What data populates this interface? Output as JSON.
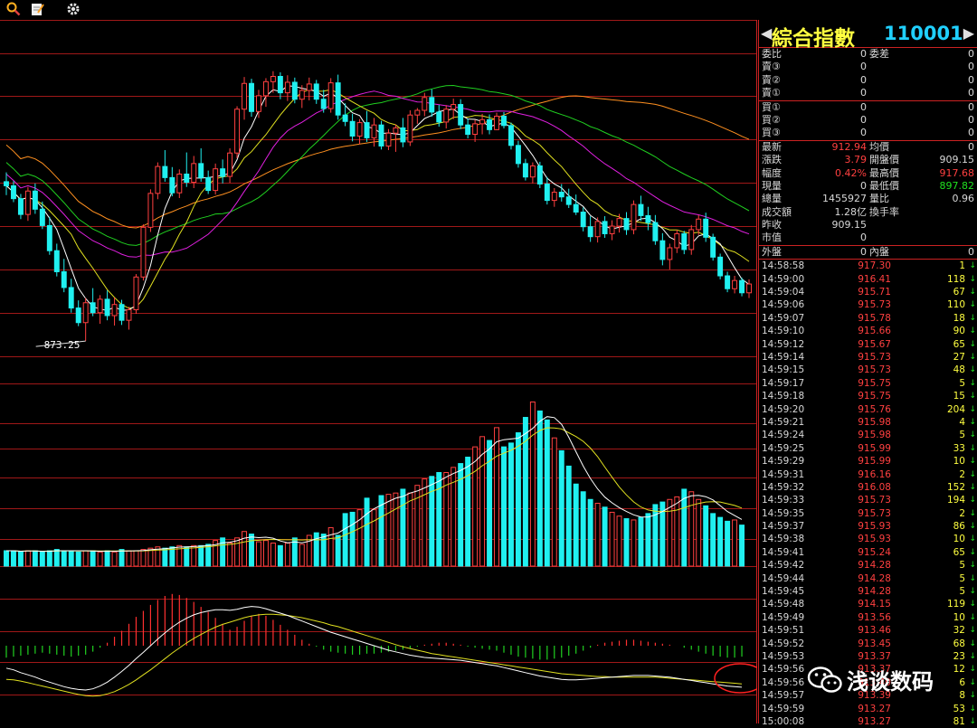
{
  "toolbar": {
    "icons": [
      "magnifier-icon",
      "notepad-icon",
      "gear-icon"
    ]
  },
  "header": {
    "name": "綜合指數",
    "code": "110001"
  },
  "quote_rows": [
    {
      "l1": "委比",
      "v1": "0",
      "l2": "委差",
      "v2": "0",
      "c1": "#d8d8d8",
      "c2": "#d8d8d8",
      "sep": false
    },
    {
      "l1": "賣③",
      "v1": "0",
      "l2": "",
      "v2": "0",
      "c1": "#d8d8d8",
      "c2": "#d8d8d8",
      "sep": false
    },
    {
      "l1": "賣②",
      "v1": "0",
      "l2": "",
      "v2": "0",
      "c1": "#d8d8d8",
      "c2": "#d8d8d8",
      "sep": false
    },
    {
      "l1": "賣①",
      "v1": "0",
      "l2": "",
      "v2": "0",
      "c1": "#d8d8d8",
      "c2": "#d8d8d8",
      "sep": true
    },
    {
      "l1": "買①",
      "v1": "0",
      "l2": "",
      "v2": "0",
      "c1": "#d8d8d8",
      "c2": "#d8d8d8",
      "sep": false
    },
    {
      "l1": "買②",
      "v1": "0",
      "l2": "",
      "v2": "0",
      "c1": "#d8d8d8",
      "c2": "#d8d8d8",
      "sep": false
    },
    {
      "l1": "買③",
      "v1": "0",
      "l2": "",
      "v2": "0",
      "c1": "#d8d8d8",
      "c2": "#d8d8d8",
      "sep": true
    },
    {
      "l1": "最新",
      "v1": "912.94",
      "l2": "均價",
      "v2": "0",
      "c1": "#ff4040",
      "c2": "#d8d8d8",
      "sep": false
    },
    {
      "l1": "漲跌",
      "v1": "3.79",
      "l2": "開盤價",
      "v2": "909.15",
      "c1": "#ff4040",
      "c2": "#d8d8d8",
      "sep": false
    },
    {
      "l1": "幅度",
      "v1": "0.42%",
      "l2": "最高價",
      "v2": "917.68",
      "c1": "#ff4040",
      "c2": "#ff4040",
      "sep": false
    },
    {
      "l1": "現量",
      "v1": "0",
      "l2": "最低價",
      "v2": "897.82",
      "c1": "#d8d8d8",
      "c2": "#20e020",
      "sep": false
    },
    {
      "l1": "總量",
      "v1": "1455927",
      "l2": "量比",
      "v2": "0.96",
      "c1": "#d8d8d8",
      "c2": "#d8d8d8",
      "sep": false
    },
    {
      "l1": "成交額",
      "v1": "1.28亿",
      "l2": "換手率",
      "v2": "",
      "c1": "#d8d8d8",
      "c2": "#d8d8d8",
      "sep": false
    },
    {
      "l1": "昨收",
      "v1": "909.15",
      "l2": "",
      "v2": "",
      "c1": "#d8d8d8",
      "c2": "#d8d8d8",
      "sep": false
    },
    {
      "l1": "市值",
      "v1": "0",
      "l2": "",
      "v2": "",
      "c1": "#d8d8d8",
      "c2": "#d8d8d8",
      "sep": true
    },
    {
      "l1": "外盤",
      "v1": "0",
      "l2": "內盤",
      "v2": "0",
      "c1": "#d8d8d8",
      "c2": "#d8d8d8",
      "sep": true
    }
  ],
  "ticks": [
    {
      "t": "14:58:58",
      "p": "917.30",
      "q": "1",
      "dir": "down"
    },
    {
      "t": "14:59:00",
      "p": "916.41",
      "q": "118",
      "dir": "down"
    },
    {
      "t": "14:59:04",
      "p": "915.71",
      "q": "67",
      "dir": "down"
    },
    {
      "t": "14:59:06",
      "p": "915.73",
      "q": "110",
      "dir": "down"
    },
    {
      "t": "14:59:07",
      "p": "915.78",
      "q": "18",
      "dir": "down"
    },
    {
      "t": "14:59:10",
      "p": "915.66",
      "q": "90",
      "dir": "down"
    },
    {
      "t": "14:59:12",
      "p": "915.67",
      "q": "65",
      "dir": "down"
    },
    {
      "t": "14:59:14",
      "p": "915.73",
      "q": "27",
      "dir": "down"
    },
    {
      "t": "14:59:15",
      "p": "915.73",
      "q": "48",
      "dir": "down"
    },
    {
      "t": "14:59:17",
      "p": "915.75",
      "q": "5",
      "dir": "down"
    },
    {
      "t": "14:59:18",
      "p": "915.75",
      "q": "15",
      "dir": "down"
    },
    {
      "t": "14:59:20",
      "p": "915.76",
      "q": "204",
      "dir": "down"
    },
    {
      "t": "14:59:21",
      "p": "915.98",
      "q": "4",
      "dir": "down"
    },
    {
      "t": "14:59:24",
      "p": "915.98",
      "q": "5",
      "dir": "down"
    },
    {
      "t": "14:59:25",
      "p": "915.99",
      "q": "33",
      "dir": "down"
    },
    {
      "t": "14:59:29",
      "p": "915.99",
      "q": "10",
      "dir": "down"
    },
    {
      "t": "14:59:31",
      "p": "916.16",
      "q": "2",
      "dir": "down"
    },
    {
      "t": "14:59:32",
      "p": "916.08",
      "q": "152",
      "dir": "down"
    },
    {
      "t": "14:59:33",
      "p": "915.73",
      "q": "194",
      "dir": "down"
    },
    {
      "t": "14:59:35",
      "p": "915.73",
      "q": "2",
      "dir": "down"
    },
    {
      "t": "14:59:37",
      "p": "915.93",
      "q": "86",
      "dir": "down"
    },
    {
      "t": "14:59:38",
      "p": "915.93",
      "q": "10",
      "dir": "down"
    },
    {
      "t": "14:59:41",
      "p": "915.24",
      "q": "65",
      "dir": "down"
    },
    {
      "t": "14:59:42",
      "p": "914.28",
      "q": "5",
      "dir": "down"
    },
    {
      "t": "14:59:44",
      "p": "914.28",
      "q": "5",
      "dir": "down"
    },
    {
      "t": "14:59:45",
      "p": "914.28",
      "q": "5",
      "dir": "down"
    },
    {
      "t": "14:59:48",
      "p": "914.15",
      "q": "119",
      "dir": "down"
    },
    {
      "t": "14:59:49",
      "p": "913.56",
      "q": "10",
      "dir": "down"
    },
    {
      "t": "14:59:51",
      "p": "913.46",
      "q": "32",
      "dir": "down"
    },
    {
      "t": "14:59:52",
      "p": "913.45",
      "q": "68",
      "dir": "down"
    },
    {
      "t": "14:59:53",
      "p": "913.37",
      "q": "23",
      "dir": "down"
    },
    {
      "t": "14:59:56",
      "p": "913.37",
      "q": "12",
      "dir": "down"
    },
    {
      "t": "14:59:56",
      "p": "913.40",
      "q": "6",
      "dir": "down"
    },
    {
      "t": "14:59:57",
      "p": "913.39",
      "q": "8",
      "dir": "down"
    },
    {
      "t": "14:59:59",
      "p": "913.27",
      "q": "53",
      "dir": "down"
    },
    {
      "t": "15:00:08",
      "p": "913.27",
      "q": "81",
      "dir": "down"
    }
  ],
  "watermark": {
    "text": "浅谈数码"
  },
  "chart_data": {
    "type": "candlestick",
    "low_label": "873.25",
    "ylim": [
      866,
      926
    ],
    "colors": {
      "up": "#ff4040",
      "down": "#20f0f0",
      "ma5": "#ffffff",
      "ma10": "#e0e020",
      "ma20": "#e020e0",
      "ma30": "#20d020",
      "ma60": "#ff9020",
      "macd_pos": "#ff3030",
      "macd_neg": "#20d020",
      "dif": "#ffffff",
      "dea": "#e0e020"
    },
    "candles": [
      [
        900.5,
        902.1,
        898.2,
        899.8
      ],
      [
        899.8,
        900.6,
        897.0,
        897.6
      ],
      [
        897.6,
        898.4,
        894.1,
        894.9
      ],
      [
        894.9,
        899.6,
        893.8,
        898.9
      ],
      [
        898.9,
        900.2,
        895.0,
        895.8
      ],
      [
        895.8,
        897.1,
        892.4,
        893.0
      ],
      [
        893.0,
        894.5,
        888.0,
        888.7
      ],
      [
        888.7,
        889.9,
        884.3,
        885.1
      ],
      [
        885.1,
        887.3,
        881.6,
        882.4
      ],
      [
        882.4,
        883.9,
        878.1,
        878.9
      ],
      [
        878.9,
        880.2,
        875.8,
        876.4
      ],
      [
        876.4,
        880.6,
        873.25,
        879.8
      ],
      [
        879.8,
        882.3,
        877.5,
        878.1
      ],
      [
        878.1,
        881.1,
        876.2,
        880.4
      ],
      [
        880.4,
        881.9,
        876.8,
        877.6
      ],
      [
        877.6,
        880.7,
        875.9,
        879.5
      ],
      [
        879.5,
        880.3,
        876.0,
        876.8
      ],
      [
        876.8,
        879.1,
        875.2,
        878.6
      ],
      [
        878.6,
        884.7,
        877.9,
        884.2
      ],
      [
        884.2,
        893.2,
        883.6,
        892.7
      ],
      [
        892.7,
        899.2,
        891.9,
        898.5
      ],
      [
        898.5,
        903.8,
        897.5,
        903.1
      ],
      [
        903.1,
        905.9,
        900.5,
        901.2
      ],
      [
        901.2,
        903.0,
        898.0,
        898.6
      ],
      [
        898.6,
        902.6,
        897.7,
        901.8
      ],
      [
        901.8,
        905.5,
        899.6,
        900.4
      ],
      [
        900.4,
        904.9,
        899.4,
        903.6
      ],
      [
        903.6,
        906.2,
        900.5,
        901.2
      ],
      [
        901.2,
        902.4,
        898.4,
        899.0
      ],
      [
        899.0,
        903.6,
        898.3,
        902.7
      ],
      [
        902.7,
        904.3,
        900.2,
        901.4
      ],
      [
        901.4,
        906.2,
        900.3,
        905.4
      ],
      [
        905.4,
        913.4,
        904.5,
        912.9
      ],
      [
        912.9,
        918.4,
        911.1,
        917.3
      ],
      [
        917.3,
        918.1,
        911.6,
        912.5
      ],
      [
        912.5,
        916.2,
        911.4,
        915.2
      ],
      [
        915.2,
        918.2,
        913.3,
        917.6
      ],
      [
        917.6,
        919.4,
        915.7,
        918.5
      ],
      [
        918.5,
        919.2,
        914.6,
        915.7
      ],
      [
        915.7,
        918.7,
        914.3,
        917.5
      ],
      [
        917.5,
        918.3,
        913.9,
        914.6
      ],
      [
        914.6,
        917.0,
        913.1,
        916.1
      ],
      [
        916.1,
        918.3,
        914.4,
        917.2
      ],
      [
        917.2,
        917.9,
        913.8,
        914.6
      ],
      [
        914.6,
        916.2,
        912.3,
        913.0
      ],
      [
        913.0,
        918.2,
        912.3,
        917.4
      ],
      [
        917.4,
        918.8,
        911.1,
        911.9
      ],
      [
        911.9,
        913.9,
        910.0,
        910.8
      ],
      [
        910.8,
        912.1,
        907.4,
        908.3
      ],
      [
        908.3,
        911.2,
        906.9,
        910.6
      ],
      [
        910.6,
        912.6,
        907.3,
        908.0
      ],
      [
        908.0,
        911.4,
        906.5,
        910.2
      ],
      [
        910.2,
        910.9,
        906.0,
        906.6
      ],
      [
        906.6,
        909.5,
        905.9,
        908.8
      ],
      [
        908.8,
        910.3,
        905.6,
        909.7
      ],
      [
        909.7,
        911.4,
        906.4,
        907.3
      ],
      [
        907.3,
        912.7,
        906.6,
        911.9
      ],
      [
        911.9,
        913.1,
        910.4,
        912.7
      ],
      [
        912.7,
        915.7,
        911.7,
        914.9
      ],
      [
        914.9,
        916.3,
        911.6,
        912.4
      ],
      [
        912.4,
        913.6,
        909.9,
        910.7
      ],
      [
        910.7,
        913.6,
        909.6,
        912.9
      ],
      [
        912.9,
        914.7,
        911.2,
        913.7
      ],
      [
        913.7,
        914.6,
        909.5,
        910.2
      ],
      [
        910.2,
        911.3,
        907.9,
        908.6
      ],
      [
        908.6,
        911.1,
        907.3,
        910.4
      ],
      [
        910.4,
        912.1,
        908.6,
        911.1
      ],
      [
        911.1,
        912.0,
        908.6,
        909.4
      ],
      [
        909.4,
        912.3,
        909.3,
        911.7
      ],
      [
        911.7,
        912.4,
        909.6,
        910.1
      ],
      [
        910.1,
        910.6,
        906.0,
        906.7
      ],
      [
        906.7,
        907.5,
        902.9,
        903.6
      ],
      [
        903.6,
        904.4,
        900.7,
        901.3
      ],
      [
        901.3,
        903.8,
        900.2,
        903.2
      ],
      [
        903.2,
        903.9,
        899.4,
        900.1
      ],
      [
        900.1,
        901.3,
        896.6,
        897.3
      ],
      [
        897.3,
        899.4,
        896.2,
        898.7
      ],
      [
        898.7,
        900.1,
        897.1,
        897.9
      ],
      [
        897.9,
        899.3,
        896.0,
        896.6
      ],
      [
        896.6,
        898.3,
        894.8,
        895.3
      ],
      [
        895.3,
        896.1,
        892.0,
        892.8
      ],
      [
        892.8,
        894.6,
        890.2,
        891.1
      ],
      [
        891.1,
        894.4,
        890.1,
        893.7
      ],
      [
        893.7,
        894.6,
        890.9,
        891.6
      ],
      [
        891.6,
        893.9,
        890.5,
        892.9
      ],
      [
        892.9,
        895.0,
        891.8,
        894.2
      ],
      [
        894.2,
        895.3,
        891.4,
        892.3
      ],
      [
        892.3,
        897.3,
        891.5,
        896.6
      ],
      [
        896.6,
        898.1,
        893.8,
        894.7
      ],
      [
        894.7,
        896.2,
        892.2,
        893.5
      ],
      [
        893.5,
        894.8,
        889.7,
        890.4
      ],
      [
        890.4,
        891.7,
        886.2,
        887.2
      ],
      [
        887.2,
        889.9,
        885.5,
        889.2
      ],
      [
        889.2,
        892.3,
        888.3,
        891.6
      ],
      [
        891.6,
        892.1,
        888.1,
        888.9
      ],
      [
        888.9,
        893.1,
        888.0,
        892.3
      ],
      [
        892.3,
        894.8,
        891.4,
        894.1
      ],
      [
        894.1,
        895.2,
        890.2,
        891.0
      ],
      [
        891.0,
        891.6,
        887.0,
        887.6
      ],
      [
        887.6,
        888.2,
        883.8,
        884.4
      ],
      [
        884.4,
        885.1,
        881.6,
        882.2
      ],
      [
        882.2,
        884.4,
        881.4,
        883.6
      ],
      [
        883.6,
        884.1,
        880.9,
        881.5
      ],
      [
        881.5,
        883.8,
        880.6,
        883.0
      ]
    ],
    "volume": [
      12,
      12,
      11,
      12,
      12,
      11,
      12,
      13,
      12,
      12,
      11,
      12,
      12,
      11,
      12,
      11,
      13,
      12,
      12,
      13,
      14,
      15,
      14,
      15,
      16,
      15,
      16,
      16,
      17,
      20,
      22,
      18,
      22,
      27,
      25,
      19,
      20,
      18,
      16,
      18,
      22,
      17,
      24,
      26,
      25,
      30,
      24,
      41,
      42,
      44,
      53,
      44,
      55,
      56,
      57,
      60,
      57,
      63,
      68,
      70,
      73,
      73,
      77,
      80,
      85,
      93,
      101,
      98,
      108,
      93,
      96,
      104,
      116,
      128,
      121,
      114,
      100,
      90,
      78,
      64,
      58,
      52,
      49,
      46,
      42,
      39,
      37,
      36,
      38,
      41,
      48,
      50,
      52,
      54,
      60,
      58,
      52,
      47,
      41,
      38,
      35,
      36,
      32
    ],
    "macd_hist": [
      -1.2,
      -1.1,
      -1.0,
      -0.9,
      -0.8,
      -0.7,
      -0.8,
      -0.9,
      -1.0,
      -1.1,
      -1.0,
      -0.9,
      -0.6,
      -0.2,
      0.3,
      0.9,
      1.5,
      2.2,
      2.9,
      3.5,
      4.1,
      4.6,
      5.0,
      5.2,
      5.1,
      4.8,
      4.4,
      3.9,
      3.4,
      2.8,
      2.2,
      1.6,
      1.9,
      2.5,
      3.0,
      3.2,
      3.0,
      2.6,
      2.1,
      1.6,
      1.1,
      0.6,
      0.2,
      -0.1,
      -0.4,
      -0.6,
      -0.7,
      -0.8,
      -0.9,
      -0.9,
      -0.8,
      -0.8,
      -0.7,
      -0.6,
      -0.5,
      -0.4,
      -0.3,
      -0.1,
      0.1,
      0.2,
      0.3,
      0.3,
      0.2,
      0.1,
      -0.1,
      -0.2,
      -0.3,
      -0.4,
      -0.5,
      -0.7,
      -0.9,
      -1.1,
      -1.2,
      -1.3,
      -1.4,
      -1.4,
      -1.3,
      -1.2,
      -1.0,
      -0.8,
      -0.5,
      -0.2,
      0.1,
      0.3,
      0.4,
      0.5,
      0.6,
      0.6,
      0.5,
      0.4,
      0.3,
      0.2,
      0.1,
      0.0,
      -0.2,
      -0.4,
      -0.6,
      -0.8,
      -1.0,
      -1.1,
      -1.2,
      -1.2,
      -1.1
    ],
    "dif": [
      -4.0,
      -4.3,
      -4.8,
      -5.2,
      -5.6,
      -6.1,
      -6.5,
      -6.9,
      -7.3,
      -7.6,
      -7.8,
      -7.9,
      -7.7,
      -7.2,
      -6.5,
      -5.6,
      -4.6,
      -3.5,
      -2.3,
      -1.2,
      0.0,
      1.2,
      2.3,
      3.3,
      4.2,
      4.9,
      5.5,
      5.9,
      6.2,
      6.4,
      6.4,
      6.3,
      6.5,
      6.8,
      7.0,
      6.9,
      6.6,
      6.2,
      5.8,
      5.4,
      4.9,
      4.4,
      3.9,
      3.4,
      2.9,
      2.4,
      2.0,
      1.6,
      1.2,
      0.8,
      0.4,
      0.0,
      -0.4,
      -0.8,
      -1.1,
      -1.4,
      -1.7,
      -1.9,
      -2.1,
      -2.2,
      -2.3,
      -2.4,
      -2.5,
      -2.6,
      -2.8,
      -3.0,
      -3.2,
      -3.4,
      -3.6,
      -3.9,
      -4.2,
      -4.5,
      -4.8,
      -5.1,
      -5.4,
      -5.6,
      -5.8,
      -6.0,
      -6.1,
      -6.1,
      -6.0,
      -5.9,
      -5.8,
      -5.7,
      -5.6,
      -5.5,
      -5.4,
      -5.3,
      -5.3,
      -5.3,
      -5.4,
      -5.5,
      -5.6,
      -5.8,
      -6.0,
      -6.2,
      -6.4,
      -6.6,
      -6.8,
      -7.0,
      -7.2,
      -7.3,
      -7.4
    ],
    "dea": [
      -6.0,
      -6.1,
      -6.3,
      -6.6,
      -6.9,
      -7.2,
      -7.5,
      -7.8,
      -8.1,
      -8.4,
      -8.7,
      -8.9,
      -9.0,
      -8.9,
      -8.6,
      -8.2,
      -7.6,
      -6.9,
      -6.1,
      -5.2,
      -4.3,
      -3.3,
      -2.3,
      -1.3,
      -0.4,
      0.5,
      1.3,
      2.0,
      2.7,
      3.3,
      3.8,
      4.2,
      4.6,
      5.0,
      5.3,
      5.5,
      5.6,
      5.6,
      5.5,
      5.4,
      5.2,
      5.0,
      4.7,
      4.4,
      4.1,
      3.7,
      3.4,
      3.0,
      2.6,
      2.2,
      1.8,
      1.4,
      1.0,
      0.6,
      0.2,
      -0.2,
      -0.5,
      -0.8,
      -1.1,
      -1.4,
      -1.6,
      -1.8,
      -2.0,
      -2.2,
      -2.4,
      -2.6,
      -2.8,
      -3.0,
      -3.2,
      -3.4,
      -3.6,
      -3.8,
      -4.0,
      -4.2,
      -4.4,
      -4.6,
      -4.8,
      -5.0,
      -5.1,
      -5.2,
      -5.3,
      -5.4,
      -5.5,
      -5.5,
      -5.6,
      -5.6,
      -5.6,
      -5.6,
      -5.6,
      -5.6,
      -5.6,
      -5.7,
      -5.8,
      -5.9,
      -6.0,
      -6.1,
      -6.2,
      -6.3,
      -6.4,
      -6.5,
      -6.6,
      -6.7,
      -6.8
    ]
  }
}
